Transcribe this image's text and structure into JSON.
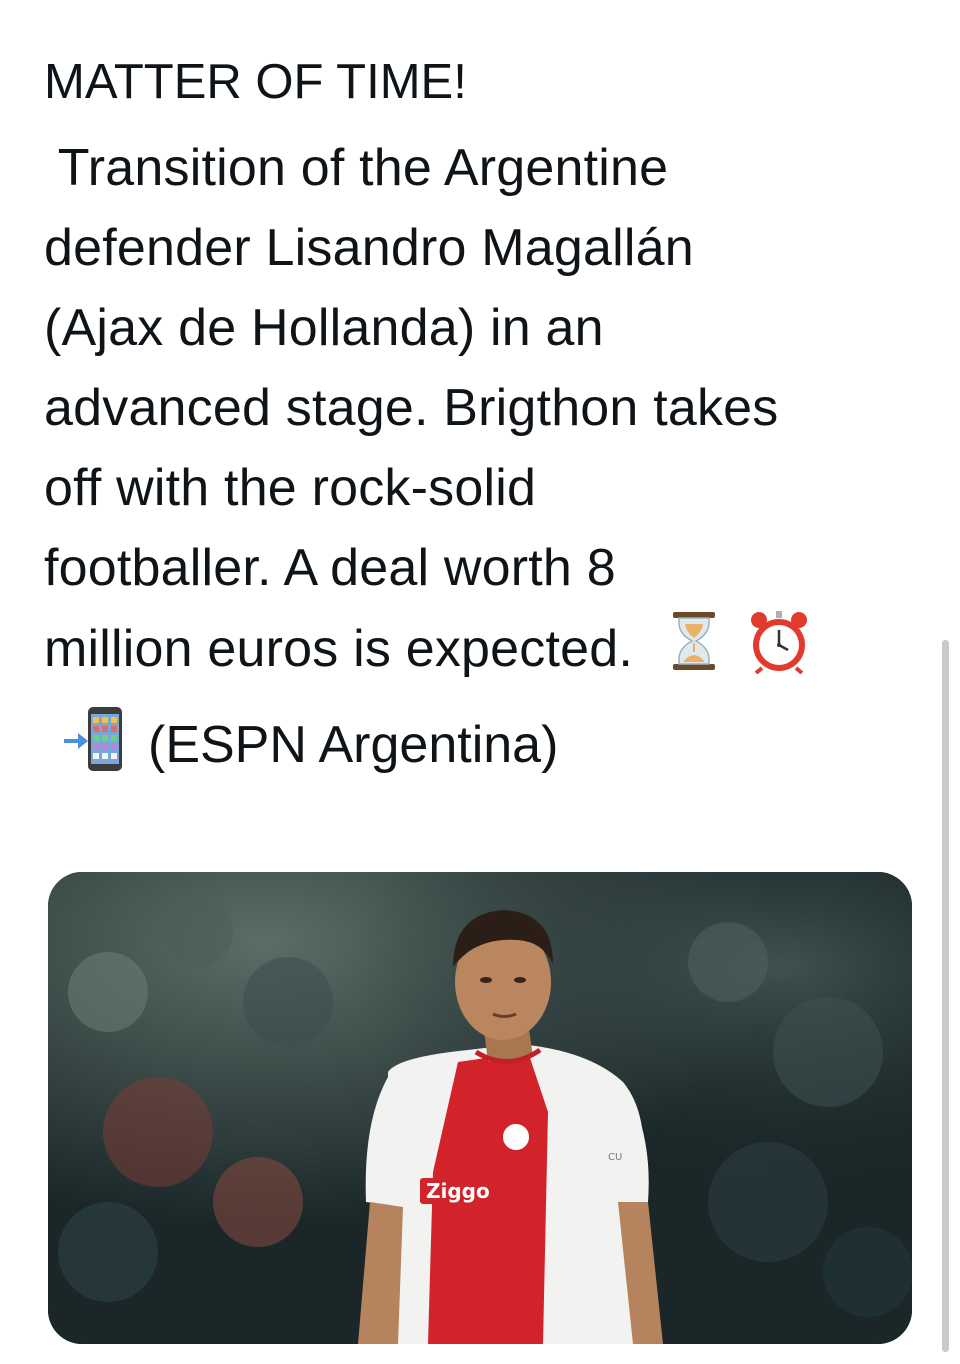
{
  "tweet": {
    "headline": "MATTER OF TIME!",
    "body_lines": [
      " Transition of the Argentine",
      "defender Lisandro Magallán",
      "(Ajax de Hollanda) in an",
      "advanced stage. Brigthon takes",
      "off with the rock-solid",
      "footballer. A deal worth 8",
      "million euros is expected."
    ],
    "emojis_end": [
      "hourglass-icon",
      "alarm-clock-icon"
    ],
    "source_emoji": "mobile-phone-arrow-icon",
    "source": "(ESPN Argentina)"
  },
  "media": {
    "jersey_sponsor": "Ziggo",
    "jersey_colors": {
      "red": "#d2232a",
      "white": "#f2f2f0"
    },
    "sleeve_text": "CU"
  },
  "colors": {
    "text": "#0f1419",
    "background": "#ffffff",
    "scrollbar": "#c9c9c9"
  }
}
